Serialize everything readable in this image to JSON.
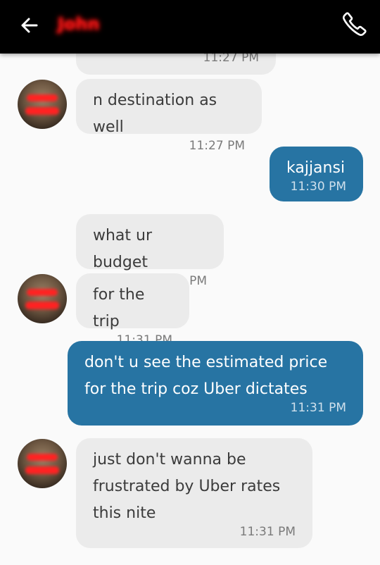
{
  "header": {
    "contact_name": "John",
    "back_icon": "arrow-left-icon",
    "call_icon": "phone-icon"
  },
  "messages": [
    {
      "direction": "incoming",
      "text": "",
      "time": "11:27 PM"
    },
    {
      "direction": "incoming",
      "text": "n destination as well",
      "time": "11:27 PM"
    },
    {
      "direction": "outgoing",
      "text": "kajjansi",
      "time": "11:30 PM"
    },
    {
      "direction": "incoming",
      "text": "what ur budget",
      "time": "11:31 PM"
    },
    {
      "direction": "incoming",
      "text": "for the trip",
      "time": "11:31 PM"
    },
    {
      "direction": "outgoing",
      "text": "don't u see the estimated price for the trip coz Uber dictates",
      "time": "11:31 PM"
    },
    {
      "direction": "incoming",
      "text": "just don't wanna be frustrated by Uber rates this nite",
      "time": "11:31 PM"
    }
  ],
  "colors": {
    "header_bg": "#000000",
    "outgoing_bubble": "#2774a3",
    "incoming_bubble": "#ebebeb",
    "background": "#fafafa"
  }
}
